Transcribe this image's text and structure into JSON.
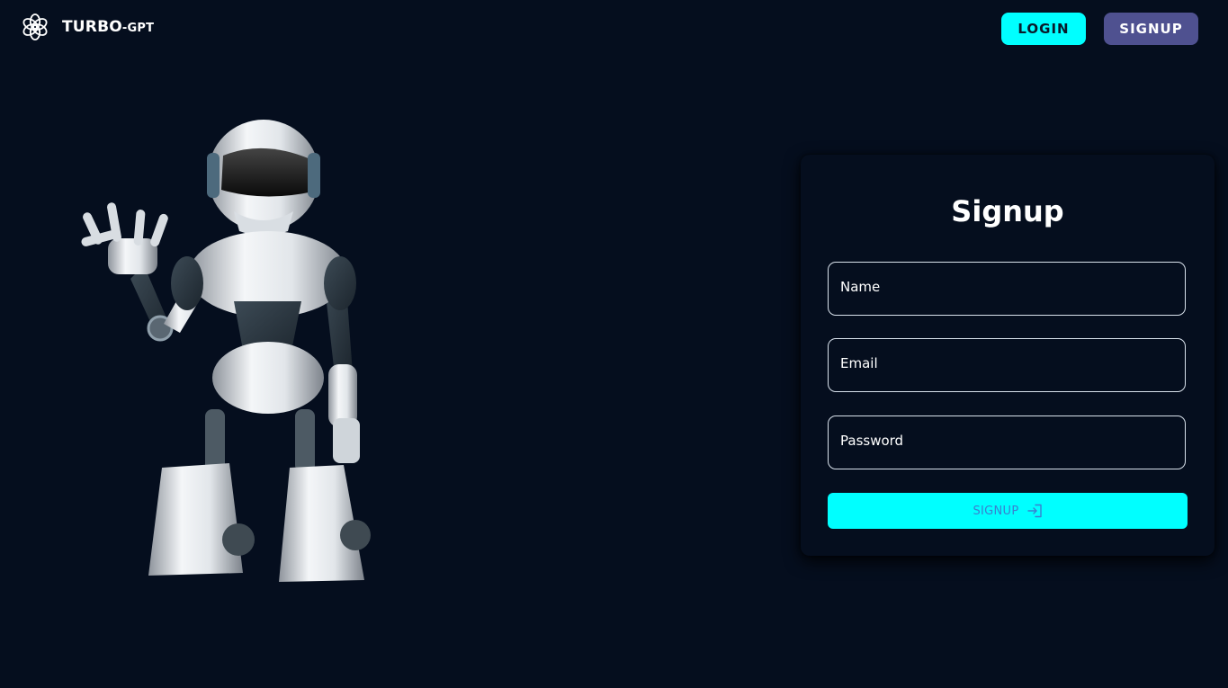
{
  "brand": {
    "name_main": "TURBO",
    "name_suffix": "-GPT",
    "logo_icon": "openai-logo-icon"
  },
  "nav": {
    "login_label": "LOGIN",
    "signup_label": "SIGNUP"
  },
  "illustration": {
    "icon": "waving-robot-illustration"
  },
  "form": {
    "title": "Signup",
    "fields": [
      {
        "label": "Name"
      },
      {
        "label": "Email"
      },
      {
        "label": "Password"
      }
    ],
    "submit_label": "SIGNUP",
    "submit_icon": "login-arrow-icon"
  },
  "colors": {
    "background": "#050e1e",
    "accent": "#00ffff",
    "secondary": "#4f5190"
  }
}
